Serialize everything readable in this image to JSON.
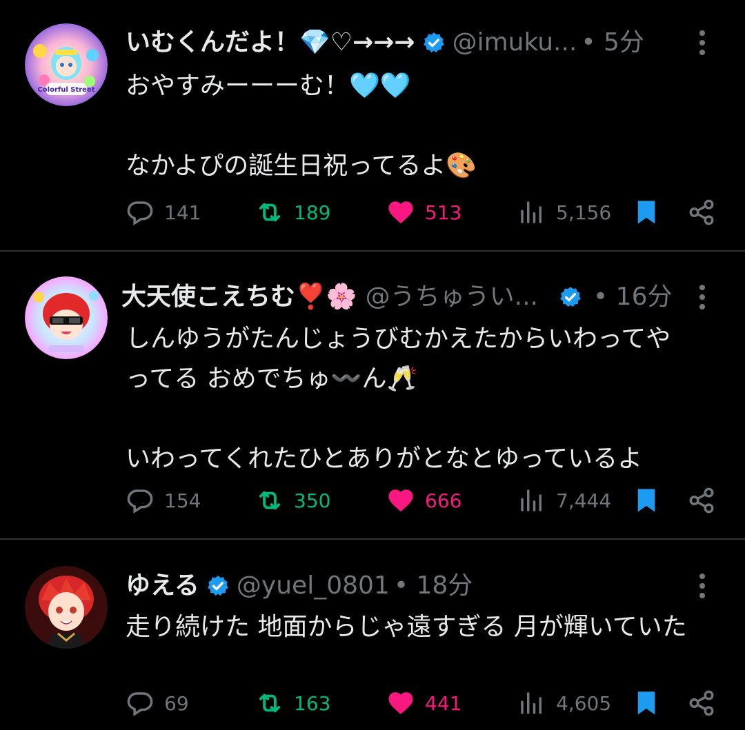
{
  "tweets": [
    {
      "display_name": "いむくんだよ！💎♡→→→",
      "handle": "@imuku...",
      "time": "• 5分",
      "text": "おやすみーーーむ！🩵🩵\n\nなかよぴの誕生日祝ってるよ🎨",
      "replies": "141",
      "retweets": "189",
      "likes": "513",
      "views": "5,156",
      "avatar_text": "Colorful Street"
    },
    {
      "display_name": "大天使こえちむ❣️🌸",
      "handle": "@うちゅうい...",
      "time": "• 16分",
      "text": "しんゆうがたんじょうびむかえたからいわってや\nってる おめでちゅ〰️ん🥂\n\nいわってくれたひとありがとなとゆっているよ",
      "replies": "154",
      "retweets": "350",
      "likes": "666",
      "views": "7,444"
    },
    {
      "display_name": "ゆえる",
      "handle": "@yuel_0801",
      "time": "• 18分",
      "text": "走り続けた 地面からじゃ遠すぎる 月が輝いていた",
      "replies": "69",
      "retweets": "163",
      "likes": "441",
      "views": "4,605"
    }
  ],
  "colors": {
    "background": "#000000",
    "text": "#e7e9ea",
    "muted": "#71767b",
    "verified": "#1d9bf0",
    "retweet": "#00ba7c",
    "like": "#f91880",
    "bookmark": "#1d9bf0"
  },
  "icons": [
    "verified-badge-icon",
    "more-icon",
    "reply-icon",
    "retweet-icon",
    "heart-icon",
    "views-icon",
    "bookmark-icon",
    "share-icon"
  ]
}
